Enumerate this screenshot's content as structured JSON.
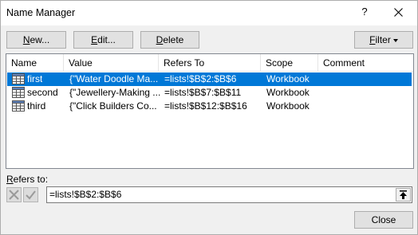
{
  "window": {
    "title": "Name Manager",
    "help": "?"
  },
  "toolbar": {
    "new": {
      "u": "N",
      "rest": "ew..."
    },
    "edit": {
      "u": "E",
      "rest": "dit..."
    },
    "delete": {
      "u": "D",
      "rest": "elete"
    },
    "filter": {
      "u": "F",
      "rest": "ilter"
    }
  },
  "table": {
    "columns": [
      "Name",
      "Value",
      "Refers To",
      "Scope",
      "Comment"
    ],
    "rows": [
      {
        "name": "first",
        "value": "{\"Water Doodle Ma...",
        "refers_to": "=lists!$B$2:$B$6",
        "scope": "Workbook",
        "comment": "",
        "selected": true
      },
      {
        "name": "second",
        "value": "{\"Jewellery-Making ...",
        "refers_to": "=lists!$B$7:$B$11",
        "scope": "Workbook",
        "comment": "",
        "selected": false
      },
      {
        "name": "third",
        "value": "{\"Click Builders Co...",
        "refers_to": "=lists!$B$12:$B$16",
        "scope": "Workbook",
        "comment": "",
        "selected": false
      }
    ]
  },
  "refers": {
    "label_u": "R",
    "label_rest": "efers to:",
    "value": "=lists!$B$2:$B$6"
  },
  "footer": {
    "close": "Close"
  },
  "colors": {
    "selection": "#0078d7",
    "button_bg": "#e1e1e1",
    "dialog_bg": "#f0f0f0"
  }
}
